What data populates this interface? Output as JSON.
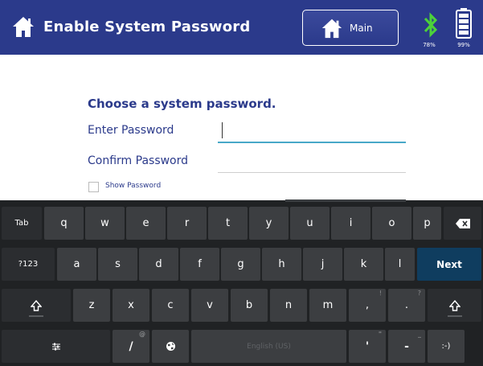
{
  "header": {
    "title": "Enable System Password",
    "main_label": "Main",
    "bluetooth_pct": "78%",
    "battery_pct": "99%",
    "background": "#2b3a8b"
  },
  "form": {
    "heading": "Choose a system password.",
    "enter_label": "Enter Password",
    "confirm_label": "Confirm Password",
    "show_label": "Show Password",
    "enter_value": "",
    "confirm_value": "",
    "show_checked": false
  },
  "keyboard": {
    "tab": "Tab",
    "row1": [
      "q",
      "w",
      "e",
      "r",
      "t",
      "y",
      "u",
      "i",
      "o",
      "p"
    ],
    "row2": [
      "a",
      "s",
      "d",
      "f",
      "g",
      "h",
      "j",
      "k",
      "l"
    ],
    "row3": [
      "z",
      "x",
      "c",
      "v",
      "b",
      "n",
      "m"
    ],
    "sym_label": "?123",
    "next_label": "Next",
    "space_label": "English (US)",
    "slash": "/",
    "slash_sup": "@",
    "comma": ",",
    "comma_sup": "!",
    "period": ".",
    "period_sup": "?",
    "apostrophe": "'",
    "apostrophe_sup": "\"",
    "dash": "-",
    "dash_sup": "_",
    "smiley": ":-)",
    "colors": {
      "key": "#3c3e41",
      "background": "#202224",
      "next": "#0f3d5f"
    }
  }
}
